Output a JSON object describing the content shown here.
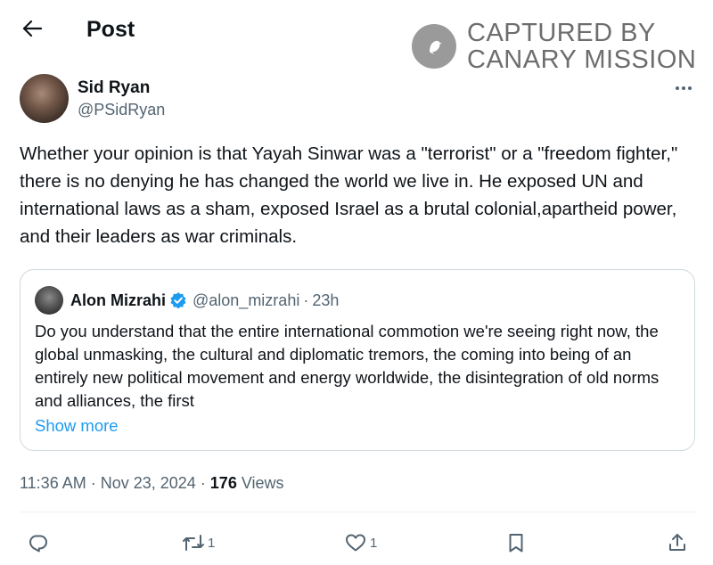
{
  "header": {
    "title": "Post",
    "back_icon": "arrow-left-icon"
  },
  "watermark": {
    "line1": "CAPTURED BY",
    "line2": "CANARY MISSION"
  },
  "author": {
    "display_name": "Sid Ryan",
    "handle": "@PSidRyan"
  },
  "tweet": {
    "text": "Whether your opinion is that Yayah Sinwar was a \"terrorist\" or a \"freedom fighter,\" there is no denying he has changed the world we live in. He exposed UN and  international laws as a sham, exposed Israel as a brutal colonial,apartheid power, and their leaders as war criminals."
  },
  "quote": {
    "display_name": "Alon Mizrahi",
    "handle": "@alon_mizrahi",
    "separator": "·",
    "time": "23h",
    "text": "Do you understand that the entire international commotion we're seeing right now, the global unmasking, the cultural and diplomatic tremors, the coming into being of an entirely new political movement and energy worldwide, the disintegration of old norms and alliances, the first",
    "show_more": "Show more"
  },
  "meta": {
    "time": "11:36 AM",
    "sep1": " · ",
    "date": "Nov 23, 2024",
    "sep2": " · ",
    "views_count": "176",
    "views_label": " Views"
  },
  "actions": {
    "reply_count": "",
    "repost_count": "1",
    "like_count": "1"
  },
  "colors": {
    "text": "#0f1419",
    "secondary": "#536471",
    "link": "#1d9bf0",
    "border": "#cfd9de"
  }
}
